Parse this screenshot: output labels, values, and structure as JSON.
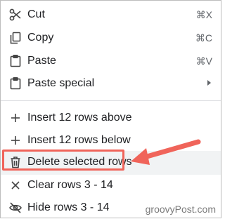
{
  "menu": {
    "items": [
      {
        "label": "Cut",
        "icon": "scissors-icon",
        "shortcut": "⌘X"
      },
      {
        "label": "Copy",
        "icon": "copy-icon",
        "shortcut": "⌘C"
      },
      {
        "label": "Paste",
        "icon": "clipboard-icon",
        "shortcut": "⌘V"
      },
      {
        "label": "Paste special",
        "icon": "clipboard-icon",
        "has_submenu": true
      },
      {
        "label": "Insert 12 rows above",
        "icon": "plus-icon"
      },
      {
        "label": "Insert 12 rows below",
        "icon": "plus-icon"
      },
      {
        "label": "Delete selected rows",
        "icon": "trash-icon",
        "highlighted": true
      },
      {
        "label": "Clear rows 3 - 14",
        "icon": "close-icon"
      },
      {
        "label": "Hide rows 3 - 14",
        "icon": "eye-off-icon"
      }
    ]
  },
  "annotation": {
    "color": "#f0645a"
  },
  "watermark": "groovyPost.com"
}
